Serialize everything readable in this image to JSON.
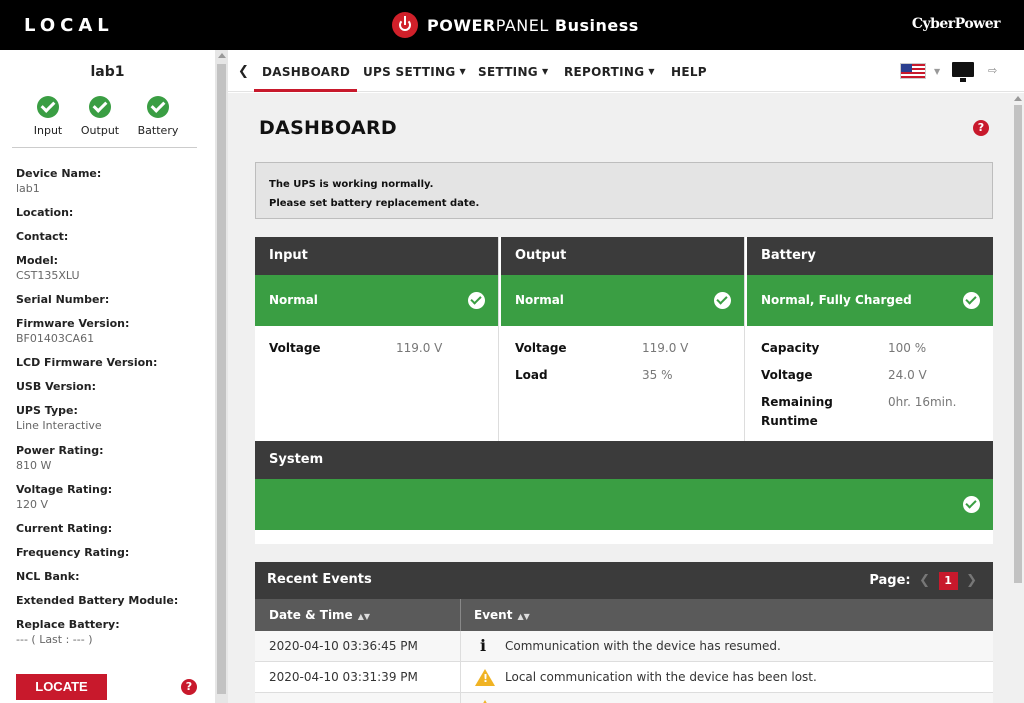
{
  "topbar": {
    "mode": "LOCAL",
    "brand_strong": "POWER",
    "brand_thin": "PANEL",
    "brand_suffix": "Business",
    "vendor": "CyberPower"
  },
  "sidebar": {
    "device_title": "lab1",
    "status": [
      {
        "label": "Input",
        "state": "ok"
      },
      {
        "label": "Output",
        "state": "ok"
      },
      {
        "label": "Battery",
        "state": "ok"
      }
    ],
    "fields": [
      {
        "label": "Device Name:",
        "value": "lab1"
      },
      {
        "label": "Location:",
        "value": ""
      },
      {
        "label": "Contact:",
        "value": ""
      },
      {
        "label": "Model:",
        "value": "CST135XLU"
      },
      {
        "label": "Serial Number:",
        "value": ""
      },
      {
        "label": "Firmware Version:",
        "value": "BF01403CA61"
      },
      {
        "label": "LCD Firmware Version:",
        "value": ""
      },
      {
        "label": "USB Version:",
        "value": ""
      },
      {
        "label": "UPS Type:",
        "value": "Line Interactive"
      },
      {
        "label": "Power Rating:",
        "value": "810 W"
      },
      {
        "label": "Voltage Rating:",
        "value": "120 V"
      },
      {
        "label": "Current Rating:",
        "value": ""
      },
      {
        "label": "Frequency Rating:",
        "value": ""
      },
      {
        "label": "NCL Bank:",
        "value": ""
      },
      {
        "label": "Extended Battery Module:",
        "value": ""
      },
      {
        "label": "Replace Battery:",
        "value": "--- ( Last : --- )"
      }
    ],
    "locate_label": "LOCATE",
    "help_glyph": "?"
  },
  "nav": {
    "back_glyph": "❮",
    "items": [
      {
        "label": "DASHBOARD",
        "caret": ""
      },
      {
        "label": "UPS SETTING",
        "caret": "▼"
      },
      {
        "label": "SETTING",
        "caret": "▼"
      },
      {
        "label": "REPORTING",
        "caret": "▼"
      },
      {
        "label": "HELP",
        "caret": ""
      }
    ],
    "flag_caret": "▼",
    "logout_glyph": "⇨"
  },
  "dashboard": {
    "title": "DASHBOARD",
    "help_glyph": "?",
    "notice_lines": [
      "The UPS is working normally.",
      "Please set battery replacement date."
    ],
    "input": {
      "heading": "Input",
      "status": "Normal",
      "rows": [
        {
          "key": "Voltage",
          "value": "119.0 V"
        }
      ]
    },
    "output": {
      "heading": "Output",
      "status": "Normal",
      "rows": [
        {
          "key": "Voltage",
          "value": "119.0 V"
        },
        {
          "key": "Load",
          "value": "35 %"
        }
      ]
    },
    "battery": {
      "heading": "Battery",
      "status": "Normal, Fully Charged",
      "rows": [
        {
          "key": "Capacity",
          "value": "100 %"
        },
        {
          "key": "Voltage",
          "value": "24.0 V"
        },
        {
          "key": "Remaining",
          "value": "0hr. 16min."
        },
        {
          "key": "Runtime",
          "value": ""
        }
      ]
    },
    "system": {
      "heading": "System"
    },
    "events": {
      "heading": "Recent Events",
      "page_label": "Page:",
      "page_number": "1",
      "prev_glyph": "❮",
      "next_glyph": "❯",
      "col_date": "Date & Time",
      "col_event": "Event",
      "sort_glyph": "▲▼",
      "rows": [
        {
          "date": "2020-04-10 03:36:45 PM",
          "type": "info",
          "message": "Communication with the device has resumed."
        },
        {
          "date": "2020-04-10 03:31:39 PM",
          "type": "warning",
          "message": "Local communication with the device has been lost."
        }
      ]
    }
  },
  "colors": {
    "accent_red": "#c8192c",
    "ok_green": "#3a9e43",
    "header_dark": "#3b3b3b"
  }
}
